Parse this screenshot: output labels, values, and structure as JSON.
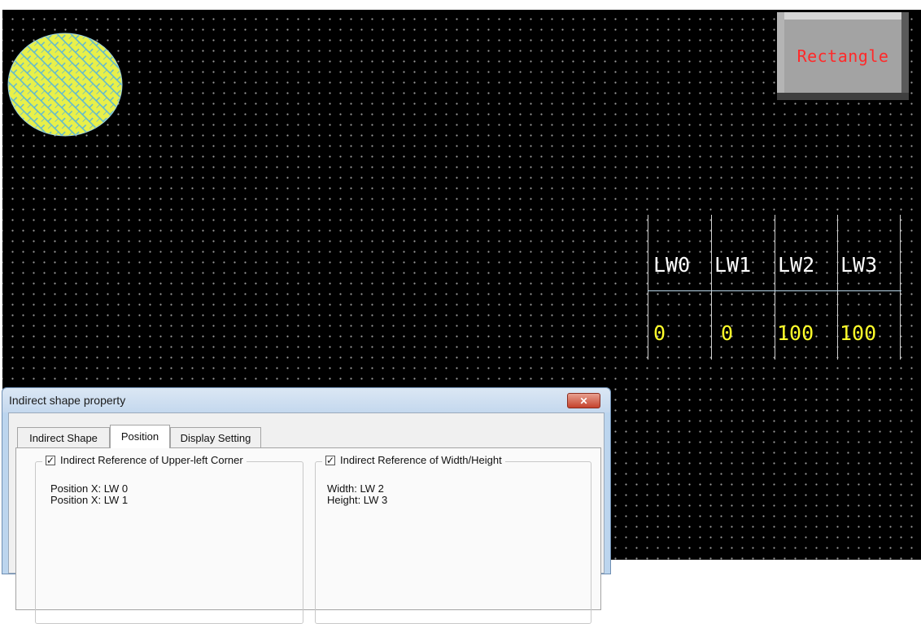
{
  "canvas": {
    "circle": {
      "fill": "#e8f04a",
      "pattern": "#5ab6d6"
    },
    "rectangle_button": {
      "label": "Rectangle",
      "text_color": "#ff2a2a"
    },
    "lw_table": {
      "headers": [
        "LW0",
        "LW1",
        "LW2",
        "LW3"
      ],
      "values": [
        "0",
        "0",
        "100",
        "100"
      ]
    }
  },
  "dialog": {
    "title": "Indirect shape property",
    "close_icon": "close-icon",
    "tabs": [
      {
        "label": "Indirect Shape",
        "active": false
      },
      {
        "label": "Position",
        "active": true
      },
      {
        "label": "Display Setting",
        "active": false
      }
    ],
    "groups": [
      {
        "title": "Indirect Reference of Upper-left Corner",
        "checked": true,
        "lines": [
          "Position X: LW 0",
          "Position X: LW 1"
        ]
      },
      {
        "title": "Indirect Reference of Width/Height",
        "checked": true,
        "lines": [
          "Width: LW 2",
          "Height: LW 3"
        ]
      }
    ]
  }
}
